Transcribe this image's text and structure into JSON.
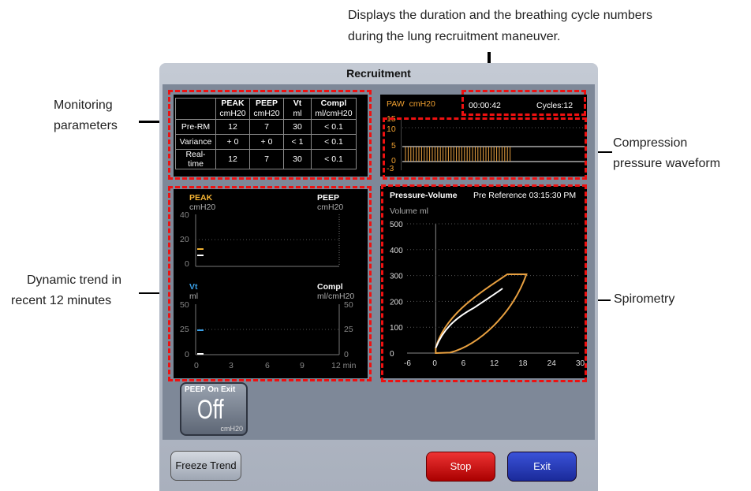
{
  "callouts": {
    "top_line1": "Displays the duration and the breathing cycle numbers",
    "top_line2": "during the lung recruitment maneuver.",
    "monitoring_line1": "Monitoring",
    "monitoring_line2": "parameters",
    "compression_line1": "Compression",
    "compression_line2": "pressure waveform",
    "trend_line1": "Dynamic trend in",
    "trend_line2": "recent 12 minutes",
    "spirometry": "Spirometry"
  },
  "window": {
    "title": "Recruitment"
  },
  "monitoring": {
    "headers": [
      {
        "name": "PEAK",
        "unit": "cmH20"
      },
      {
        "name": "PEEP",
        "unit": "cmH20"
      },
      {
        "name": "Vt",
        "unit": "ml"
      },
      {
        "name": "Compl",
        "unit": "ml/cmH20"
      }
    ],
    "rows": [
      {
        "label": "Pre-RM",
        "values": [
          "12",
          "7",
          "30",
          "< 0.1"
        ]
      },
      {
        "label": "Variance",
        "values": [
          "+ 0",
          "+ 0",
          "< 1",
          "< 0.1"
        ]
      },
      {
        "label": "Real-time",
        "values": [
          "12",
          "7",
          "30",
          "< 0.1"
        ]
      }
    ]
  },
  "waveform": {
    "label": "PAW",
    "unit": "cmH20",
    "timer": "00:00:42",
    "cycles": "Cycles:12",
    "ticks": [
      "15",
      "10",
      "5",
      "0",
      "-3"
    ]
  },
  "trend": {
    "peak_label": "PEAK",
    "peak_unit": "cmH20",
    "peep_label": "PEEP",
    "peep_unit": "cmH20",
    "top_ticks": [
      "40",
      "20",
      "0"
    ],
    "vt_label": "Vt",
    "vt_unit": "ml",
    "compl_label": "Compl",
    "compl_unit": "ml/cmH20",
    "bottom_left_ticks": [
      "50",
      "25",
      "0"
    ],
    "bottom_right_ticks": [
      "50",
      "25",
      "0"
    ],
    "x_ticks": [
      "0",
      "3",
      "6",
      "9",
      "12 min"
    ],
    "colors": {
      "peak": "#f2b233",
      "peep": "#ffffff",
      "vt": "#3aa0e8"
    }
  },
  "spirometry": {
    "title": "Pressure-Volume",
    "reference": "Pre Reference 03:15:30 PM",
    "y_label": "Volume  ml",
    "y_ticks": [
      "500",
      "400",
      "300",
      "200",
      "100",
      "0"
    ],
    "x_ticks": [
      "-6",
      "0",
      "6",
      "12",
      "18",
      "24",
      "30"
    ],
    "colors": {
      "reference": "#e8a040",
      "current": "#ffffff"
    }
  },
  "peep_on_exit": {
    "label": "PEEP On Exit",
    "value": "Off",
    "unit": "cmH20"
  },
  "buttons": {
    "freeze": "Freeze Trend",
    "stop": "Stop",
    "exit": "Exit"
  }
}
